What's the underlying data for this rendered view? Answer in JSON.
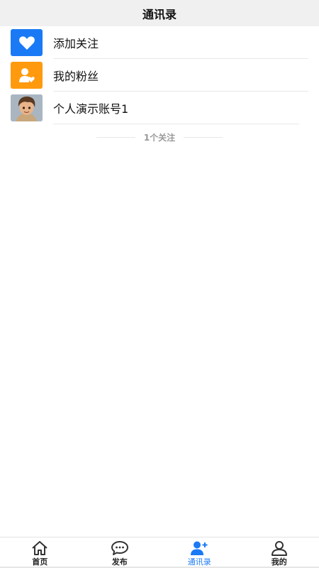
{
  "header": {
    "title": "通讯录"
  },
  "contacts": {
    "items": [
      {
        "label": "添加关注",
        "icon": "heart-icon",
        "color": "#1a7af5"
      },
      {
        "label": "我的粉丝",
        "icon": "user-heart-icon",
        "color": "#ff9a0f"
      },
      {
        "label": "个人演示账号1",
        "icon": "avatar"
      }
    ],
    "follow_count": "1个关注"
  },
  "tabbar": {
    "items": [
      {
        "label": "首页",
        "icon": "home-icon"
      },
      {
        "label": "发布",
        "icon": "chat-bubble-icon"
      },
      {
        "label": "通讯录",
        "icon": "add-user-icon",
        "active": true
      },
      {
        "label": "我的",
        "icon": "user-icon"
      }
    ],
    "accent": "#1a7af5"
  }
}
